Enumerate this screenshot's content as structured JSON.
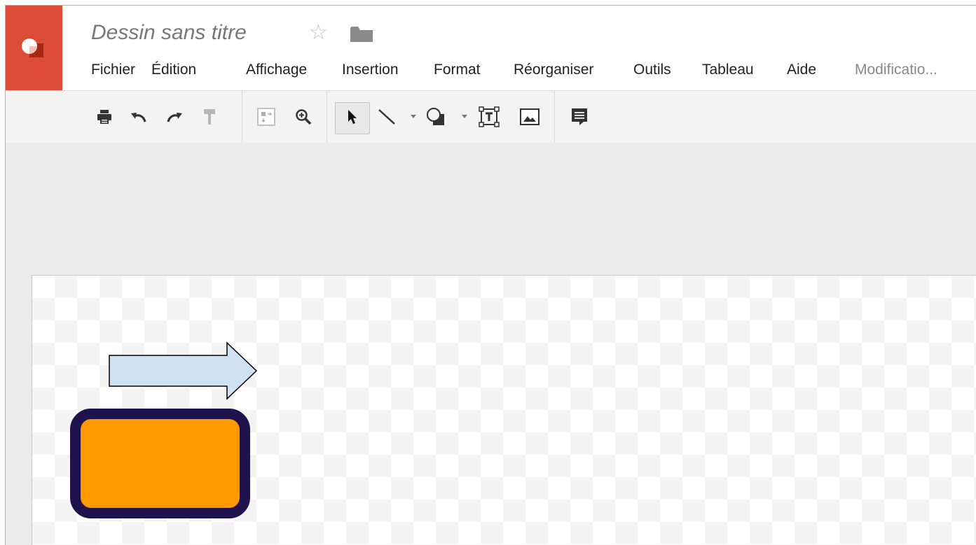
{
  "app": {
    "document_title": "Dessin sans titre",
    "star_glyph": "☆",
    "brand_color": "#dd4b39"
  },
  "menu": {
    "items": [
      {
        "label": "Fichier"
      },
      {
        "label": "Édition"
      },
      {
        "label": "Affichage"
      },
      {
        "label": "Insertion"
      },
      {
        "label": "Format"
      },
      {
        "label": "Réorganiser"
      },
      {
        "label": "Outils"
      },
      {
        "label": "Tableau"
      },
      {
        "label": "Aide"
      }
    ],
    "save_status": "Modificatio..."
  },
  "toolbar": {
    "buttons": [
      {
        "icon": "print-icon"
      },
      {
        "icon": "undo-icon"
      },
      {
        "icon": "redo-icon"
      },
      {
        "icon": "paint-format-icon",
        "disabled": true
      },
      {
        "icon": "snap-icon",
        "disabled": true
      },
      {
        "icon": "zoom-icon"
      },
      {
        "icon": "select-arrow-icon",
        "active": true
      },
      {
        "icon": "line-icon",
        "has_dropdown": true
      },
      {
        "icon": "shape-icon",
        "has_dropdown": true
      },
      {
        "icon": "text-box-icon"
      },
      {
        "icon": "image-icon"
      },
      {
        "icon": "comment-icon"
      }
    ]
  },
  "canvas": {
    "shapes": [
      {
        "type": "right-arrow",
        "fill": "#cfe2f3",
        "stroke": "#000000"
      },
      {
        "type": "rounded-rectangle",
        "fill": "#ff9900",
        "stroke": "#20124d"
      }
    ]
  }
}
